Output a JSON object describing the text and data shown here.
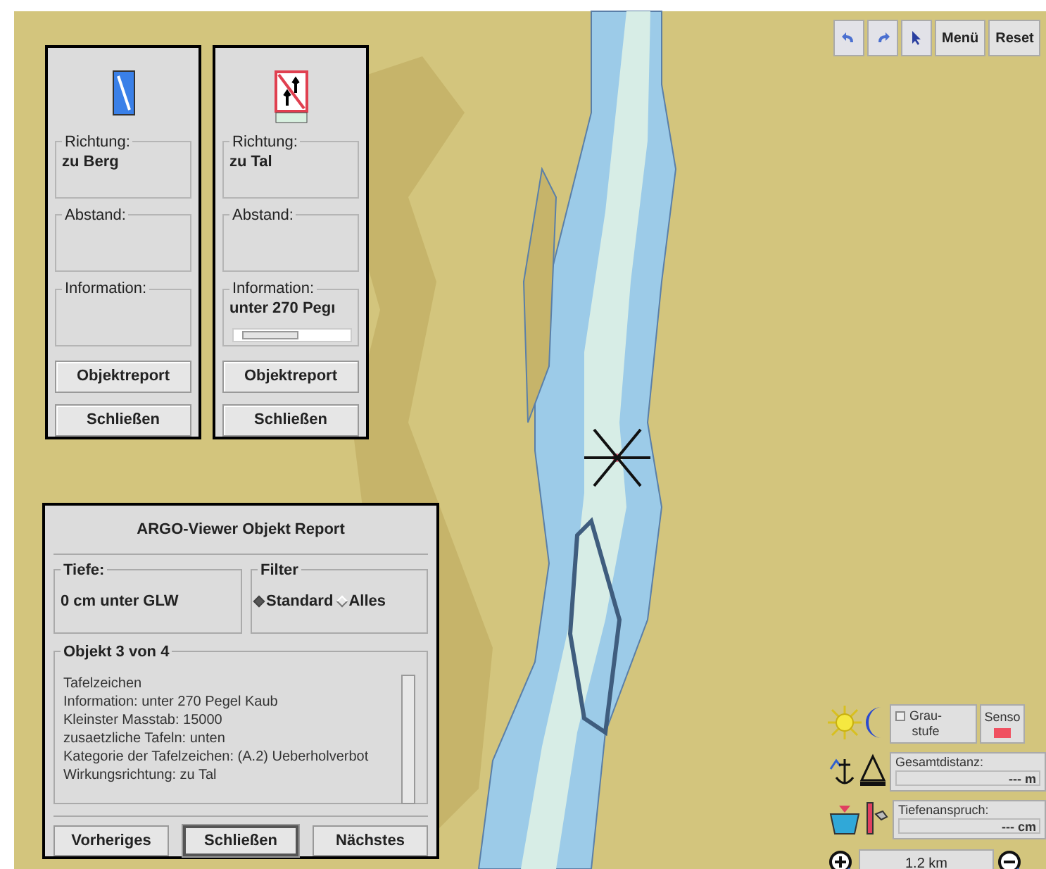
{
  "toolbar": {
    "buttons": [
      {
        "kind": "undo"
      },
      {
        "kind": "redo"
      },
      {
        "kind": "query"
      },
      {
        "kind": "text",
        "label": "Menü"
      },
      {
        "kind": "text",
        "label": "Reset"
      }
    ]
  },
  "sign_panels": [
    {
      "kind": "upstream",
      "fields": [
        {
          "label": "Richtung:",
          "value": "zu Berg"
        },
        {
          "label": "Abstand:"
        },
        {
          "label": "Information:"
        }
      ],
      "buttons": [
        "Objektreport",
        "Schließen"
      ]
    },
    {
      "kind": "no-overtaking",
      "fields": [
        {
          "label": "Richtung:",
          "value": "zu Tal"
        },
        {
          "label": "Abstand:"
        },
        {
          "label": "Information:",
          "value": "unter 270 Pegı",
          "scrollable": true
        }
      ],
      "buttons": [
        "Objektreport",
        "Schließen"
      ]
    }
  ],
  "report": {
    "title": "ARGO-Viewer Objekt Report",
    "depth": {
      "label": "Tiefe:",
      "value": "0 cm unter GLW"
    },
    "filter": {
      "label": "Filter",
      "options": [
        {
          "label": "Standard",
          "selected": true
        },
        {
          "label": "Alles",
          "selected": false
        }
      ]
    },
    "object": {
      "heading": "Objekt 3 von 4",
      "lines": [
        "Tafelzeichen",
        "Information: unter 270 Pegel Kaub",
        "Kleinster Masstab: 15000",
        "zusaetzliche Tafeln: unten",
        "Kategorie der Tafelzeichen: (A.2) Ueberholverbot",
        "Wirkungsrichtung: zu Tal"
      ]
    },
    "buttons": [
      {
        "label": "Vorheriges",
        "default": false
      },
      {
        "label": "Schließen",
        "default": true
      },
      {
        "label": "Nächstes",
        "default": false
      }
    ]
  },
  "controls": {
    "grayscale": {
      "lines": [
        "Grau-",
        "stufe"
      ],
      "checked": false
    },
    "sensor": {
      "label": "Senso",
      "on": true
    },
    "total_distance": {
      "label": "Gesamtdistanz:",
      "value": "--- m"
    },
    "depth_requirement": {
      "label": "Tiefenanspruch:",
      "value": "--- cm"
    },
    "scale": "1.2 km"
  }
}
